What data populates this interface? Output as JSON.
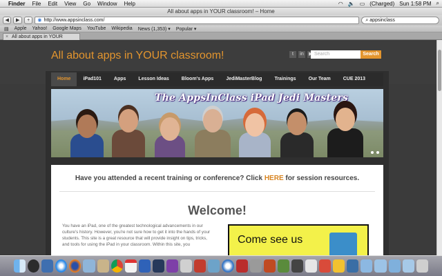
{
  "menubar": {
    "items": [
      "Finder",
      "File",
      "Edit",
      "View",
      "Go",
      "Window",
      "Help"
    ],
    "battery": "(Charged)",
    "clock": "Sun 1:58 PM"
  },
  "browser": {
    "window_title": "All about apps in YOUR classroom! – Home",
    "url": "http://www.appsinclass.com/",
    "search_value": "appsinclass",
    "bookmarks": [
      "Apple",
      "Yahoo!",
      "Google Maps",
      "YouTube",
      "Wikipedia",
      "News (1,353) ▾",
      "Popular ▾"
    ],
    "tab_title": "All about apps in YOUR classroo..."
  },
  "site": {
    "title": "All about apps in YOUR classroom!",
    "search_placeholder": "Search",
    "search_button": "Search",
    "nav": [
      "Home",
      "iPad101",
      "Apps",
      "Lesson Ideas",
      "Bloom's Apps",
      "JediMasterBlog",
      "Trainings",
      "Our Team",
      "CUE 2013"
    ],
    "banner_title": "The AppsInClass iPad Jedi Masters",
    "training_text_before": "Have you attended a recent training or conference?  Click ",
    "training_link": "HERE",
    "training_text_after": " for session resources.",
    "welcome": "Welcome!",
    "paragraph": "You have an iPad, one of the greatest technological advancements in our culture's history.  However, you're not sure how to get it into the hands of your students.  This site is a great resource that will provide insight on tips, tricks, and tools for using the iPad in your classroom.  Within this site, you",
    "promo_text": "Come see us"
  },
  "colors": {
    "accent": "#e3952e",
    "header_bg": "#3d3d3d",
    "nav_bg": "#2b2b2b",
    "promo_bg": "#f3f14a"
  }
}
